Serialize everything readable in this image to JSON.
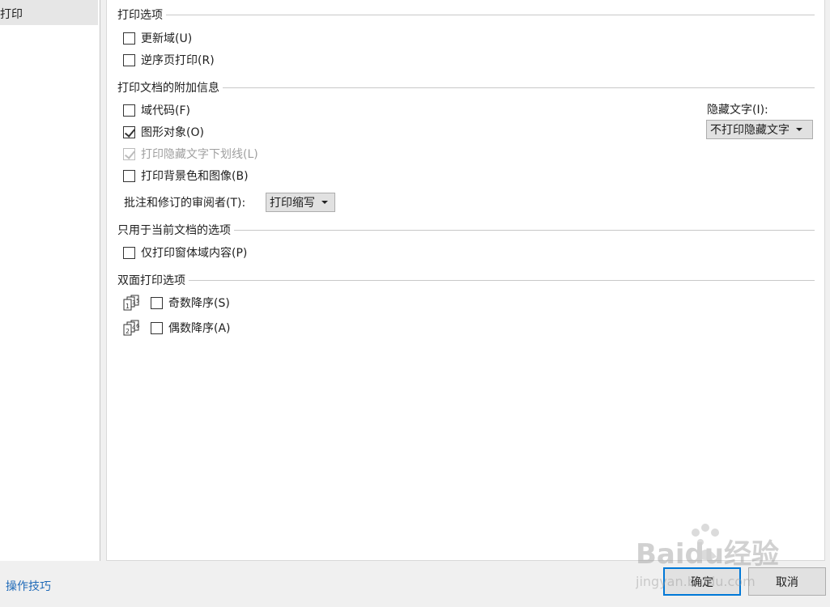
{
  "nav": {
    "active_item": "打印"
  },
  "sections": {
    "print_options": {
      "title": "打印选项",
      "items": [
        {
          "label": "更新域(U)",
          "checked": false
        },
        {
          "label": "逆序页打印(R)",
          "checked": false
        }
      ]
    },
    "extra_info": {
      "title": "打印文档的附加信息",
      "items": [
        {
          "label": "域代码(F)",
          "checked": false
        },
        {
          "label": "图形对象(O)",
          "checked": true
        },
        {
          "label": "打印隐藏文字下划线(L)",
          "checked": true,
          "disabled": true
        },
        {
          "label": "打印背景色和图像(B)",
          "checked": false
        }
      ],
      "reviewer_label": "批注和修订的审阅者(T):",
      "reviewer_value": "打印缩写",
      "hidden_text_label": "隐藏文字(I):",
      "hidden_text_value": "不打印隐藏文字"
    },
    "current_doc": {
      "title": "只用于当前文档的选项",
      "items": [
        {
          "label": "仅打印窗体域内容(P)",
          "checked": false
        }
      ]
    },
    "duplex": {
      "title": "双面打印选项",
      "items": [
        {
          "label": "奇数降序(S)",
          "checked": false,
          "icon": "odd-pages-icon",
          "digits": "135"
        },
        {
          "label": "偶数降序(A)",
          "checked": false,
          "icon": "even-pages-icon",
          "digits": "246"
        }
      ]
    }
  },
  "footer": {
    "link": "操作技巧",
    "ok": "确定",
    "cancel": "取消"
  },
  "watermark": {
    "brand": "Baidu经验",
    "url": "jingyan.baidu.com"
  },
  "colors": {
    "accent": "#0078d7",
    "link": "#1f6ab8"
  }
}
